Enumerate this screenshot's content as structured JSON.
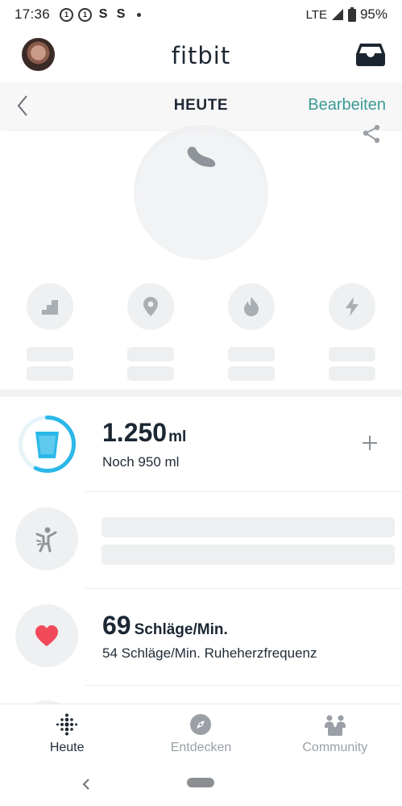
{
  "status_bar": {
    "time": "17:36",
    "network": "LTE",
    "battery": "95%",
    "notification_icons": [
      "tagesschau-icon",
      "tagesschau-icon",
      "s-icon",
      "s-icon"
    ]
  },
  "header": {
    "app_logo": "fitbit",
    "avatar_icon": "user-avatar",
    "inbox_icon": "inbox-icon"
  },
  "subheader": {
    "title": "HEUTE",
    "edit_label": "Bearbeiten",
    "accent_color": "#3a9a96"
  },
  "summary": {
    "main_icon": "shoe-icon",
    "stats": [
      {
        "icon": "stairs-icon"
      },
      {
        "icon": "location-pin-icon"
      },
      {
        "icon": "flame-icon"
      },
      {
        "icon": "lightning-icon"
      }
    ]
  },
  "tiles": {
    "water": {
      "value": "1.250",
      "unit": "ml",
      "subtitle": "Noch 950 ml",
      "progress": 0.57,
      "ring_color": "#2bb8e8"
    },
    "heart_rate": {
      "value": "69",
      "unit": "Schläge/Min.",
      "subtitle": "54 Schläge/Min. Ruheherzfrequenz",
      "heart_color": "#f04a5a"
    }
  },
  "bottom_nav": {
    "items": [
      {
        "label": "Heute",
        "icon": "fitbit-dots-icon",
        "active": true
      },
      {
        "label": "Entdecken",
        "icon": "compass-icon",
        "active": false
      },
      {
        "label": "Community",
        "icon": "community-icon",
        "active": false
      }
    ]
  }
}
